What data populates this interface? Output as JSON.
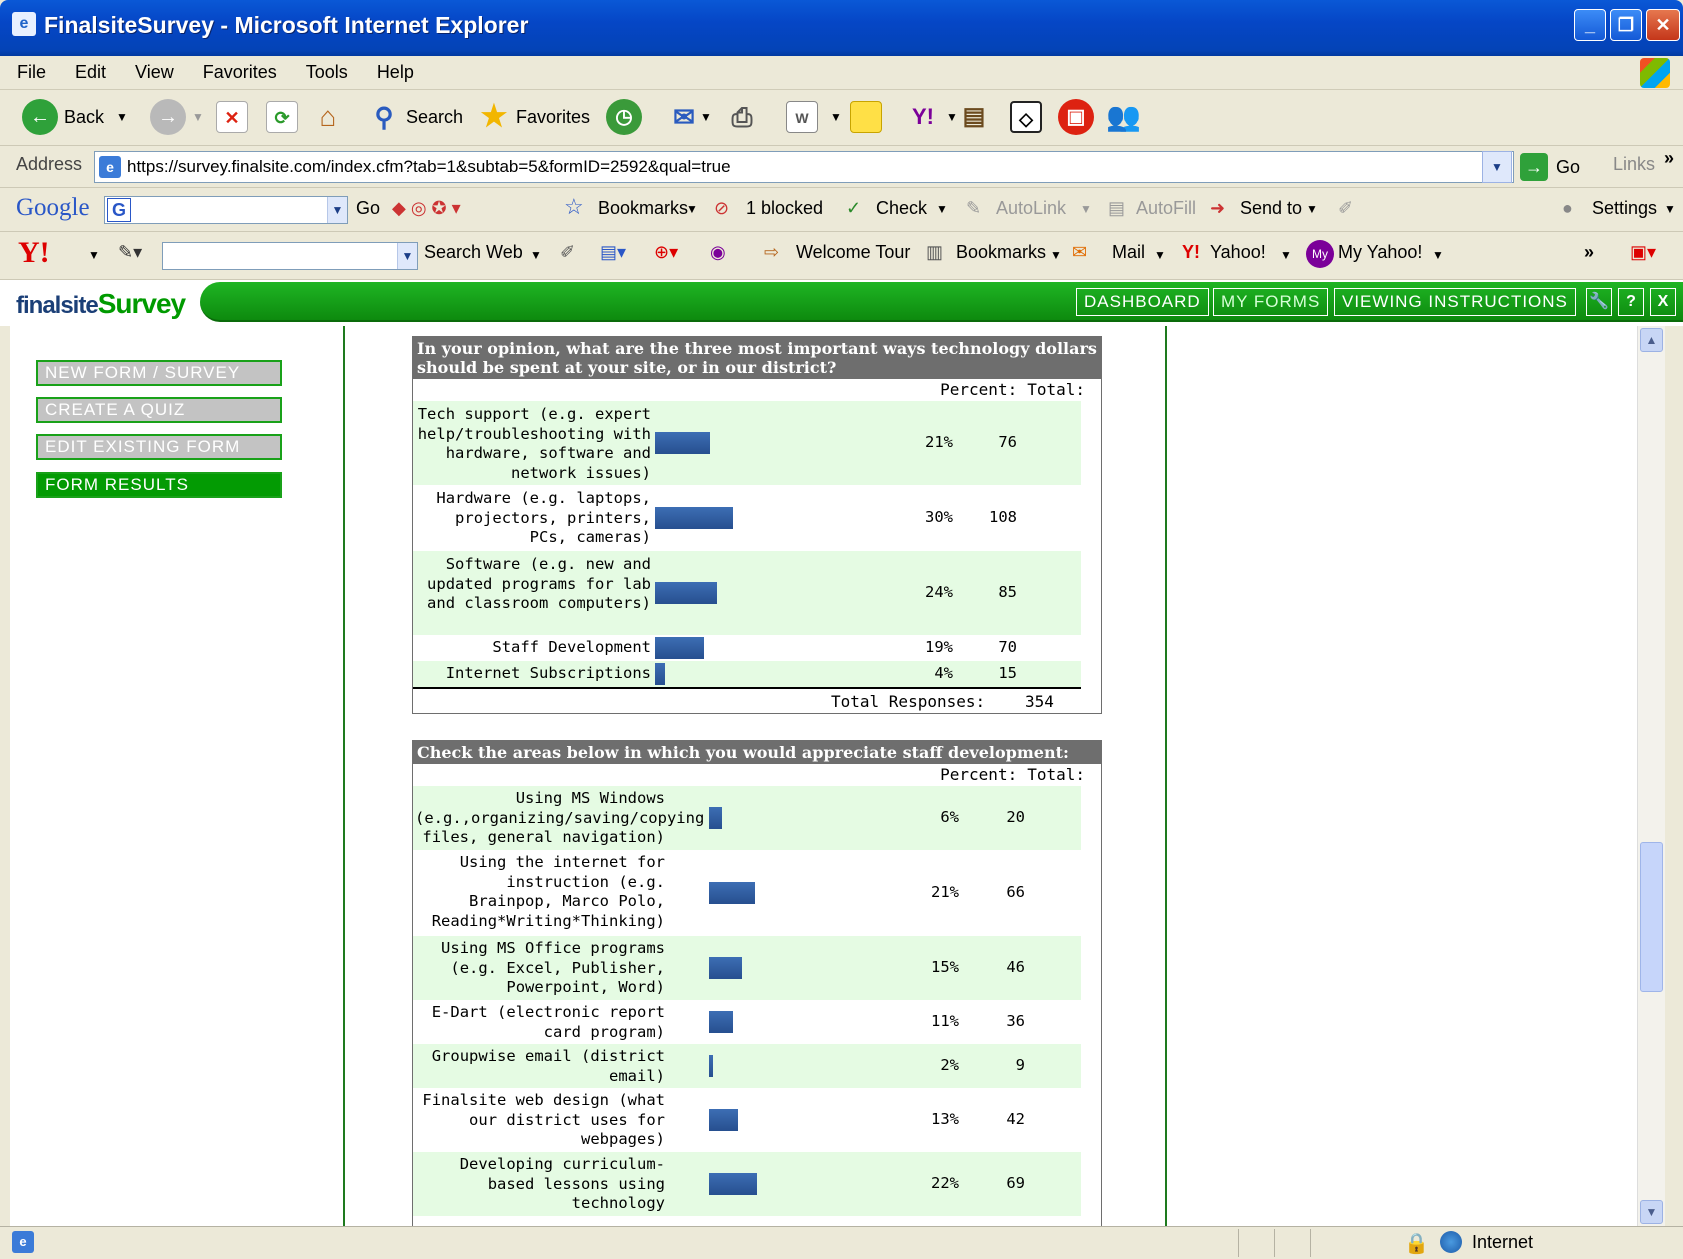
{
  "window": {
    "title": "FinalsiteSurvey - Microsoft Internet Explorer"
  },
  "menu": [
    "File",
    "Edit",
    "View",
    "Favorites",
    "Tools",
    "Help"
  ],
  "toolbar": {
    "back": "Back",
    "search": "Search",
    "favorites": "Favorites"
  },
  "address": {
    "label": "Address",
    "url": "https://survey.finalsite.com/index.cfm?tab=1&subtab=5&formID=2592&qual=true",
    "go": "Go",
    "links": "Links"
  },
  "googlebar": {
    "logo": "Google",
    "go": "Go",
    "bookmarks": "Bookmarks",
    "blocked": "1 blocked",
    "check": "Check",
    "autolink": "AutoLink",
    "autofill": "AutoFill",
    "sendto": "Send to",
    "settings": "Settings"
  },
  "yahoobar": {
    "search_web": "Search Web",
    "welcome_tour": "Welcome Tour",
    "bookmarks": "Bookmarks",
    "mail": "Mail",
    "yahoo": "Yahoo!",
    "my_yahoo": "My Yahoo!"
  },
  "app": {
    "logo_a": "finalsite",
    "logo_b": "Survey",
    "nav": [
      "DASHBOARD",
      "MY FORMS",
      "VIEWING INSTRUCTIONS"
    ],
    "icons": [
      "wrench-icon",
      "help-icon",
      "close-icon"
    ]
  },
  "sidebar": [
    "NEW FORM / SURVEY",
    "CREATE A QUIZ",
    "EDIT EXISTING FORM",
    "FORM RESULTS"
  ],
  "col_percent": "Percent:",
  "col_total": "Total:",
  "q1": {
    "question": "In your opinion, what are the three most important ways technology dollars should be spent at your site, or in our district?",
    "rows": [
      {
        "label": "Tech support (e.g. expert help/troubleshooting with hardware, software and network issues)",
        "percent": "21%",
        "total": "76",
        "value": 21
      },
      {
        "label": "Hardware (e.g. laptops, projectors, printers, PCs, cameras)",
        "percent": "30%",
        "total": "108",
        "value": 30
      },
      {
        "label": "Software (e.g. new and updated programs for lab and classroom computers)",
        "percent": "24%",
        "total": "85",
        "value": 24
      },
      {
        "label": "Staff Development",
        "percent": "19%",
        "total": "70",
        "value": 19
      },
      {
        "label": "Internet Subscriptions",
        "percent": "4%",
        "total": "15",
        "value": 4
      }
    ],
    "total_label": "Total Responses:",
    "total_value": "354"
  },
  "q2": {
    "question": "Check the areas below in which you would appreciate staff development:",
    "rows": [
      {
        "label": "Using MS Windows (e.g.,organizing/saving/copying files, general navigation)",
        "percent": "6%",
        "total": "20",
        "value": 6
      },
      {
        "label": "Using the internet for instruction (e.g. Brainpop, Marco Polo, Reading*Writing*Thinking)",
        "percent": "21%",
        "total": "66",
        "value": 21
      },
      {
        "label": "Using MS Office programs (e.g. Excel, Publisher, Powerpoint, Word)",
        "percent": "15%",
        "total": "46",
        "value": 15
      },
      {
        "label": "E-Dart (electronic report card program)",
        "percent": "11%",
        "total": "36",
        "value": 11
      },
      {
        "label": "Groupwise email (district email)",
        "percent": "2%",
        "total": "9",
        "value": 2
      },
      {
        "label": "Finalsite web design (what our district uses for webpages)",
        "percent": "13%",
        "total": "42",
        "value": 13
      },
      {
        "label": "Developing curriculum-based lessons using technology",
        "percent": "22%",
        "total": "69",
        "value": 22
      }
    ]
  },
  "status": {
    "zone": "Internet"
  }
}
